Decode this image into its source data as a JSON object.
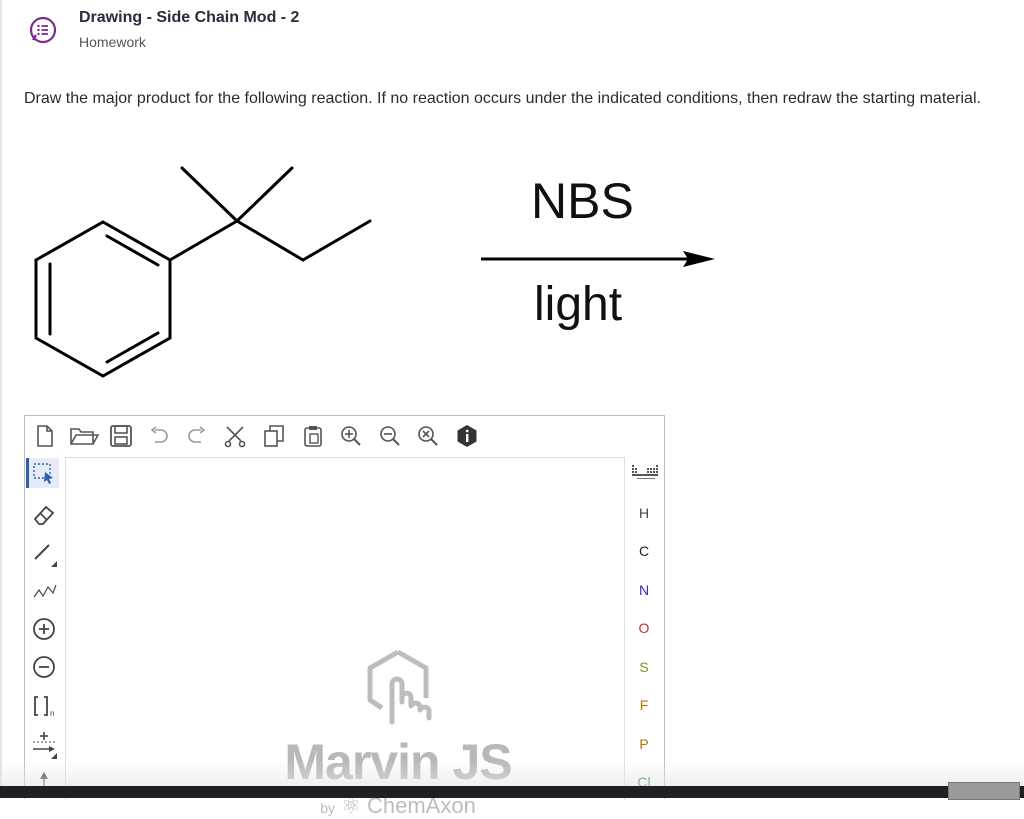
{
  "header": {
    "title": "Drawing - Side Chain Mod - 2",
    "subtitle": "Homework",
    "icon": "chat-list-icon",
    "accent": "#7b2d8e"
  },
  "question": {
    "text": "Draw the major product for the following reaction. If no reaction occurs under the indicated conditions, then redraw the starting material."
  },
  "reaction": {
    "reagent_top": "NBS",
    "reagent_bottom": "light"
  },
  "editor": {
    "top_toolbar": [
      "new-document-icon",
      "open-folder-icon",
      "save-icon",
      "undo-icon",
      "redo-icon",
      "cut-icon",
      "copy-icon",
      "paste-icon",
      "zoom-in-icon",
      "zoom-out-icon",
      "zoom-reset-icon",
      "info-icon"
    ],
    "left_toolbar": [
      "rectangle-select-icon",
      "eraser-icon",
      "single-bond-icon",
      "chain-icon",
      "positive-charge-icon",
      "negative-charge-icon",
      "bracket-icon",
      "reaction-arrow-icon"
    ],
    "bracket_subscript": "n",
    "atoms": [
      {
        "symbol": "H",
        "color": "#444444"
      },
      {
        "symbol": "C",
        "color": "#222222"
      },
      {
        "symbol": "N",
        "color": "#2d2db4"
      },
      {
        "symbol": "O",
        "color": "#d42a2a"
      },
      {
        "symbol": "S",
        "color": "#8a8a22"
      },
      {
        "symbol": "F",
        "color": "#b07a10"
      },
      {
        "symbol": "P",
        "color": "#c07000"
      },
      {
        "symbol": "Cl",
        "color": "#2a8a2a"
      }
    ],
    "watermark": {
      "name": "Marvin JS",
      "by": "by",
      "company": "ChemAxon"
    }
  }
}
